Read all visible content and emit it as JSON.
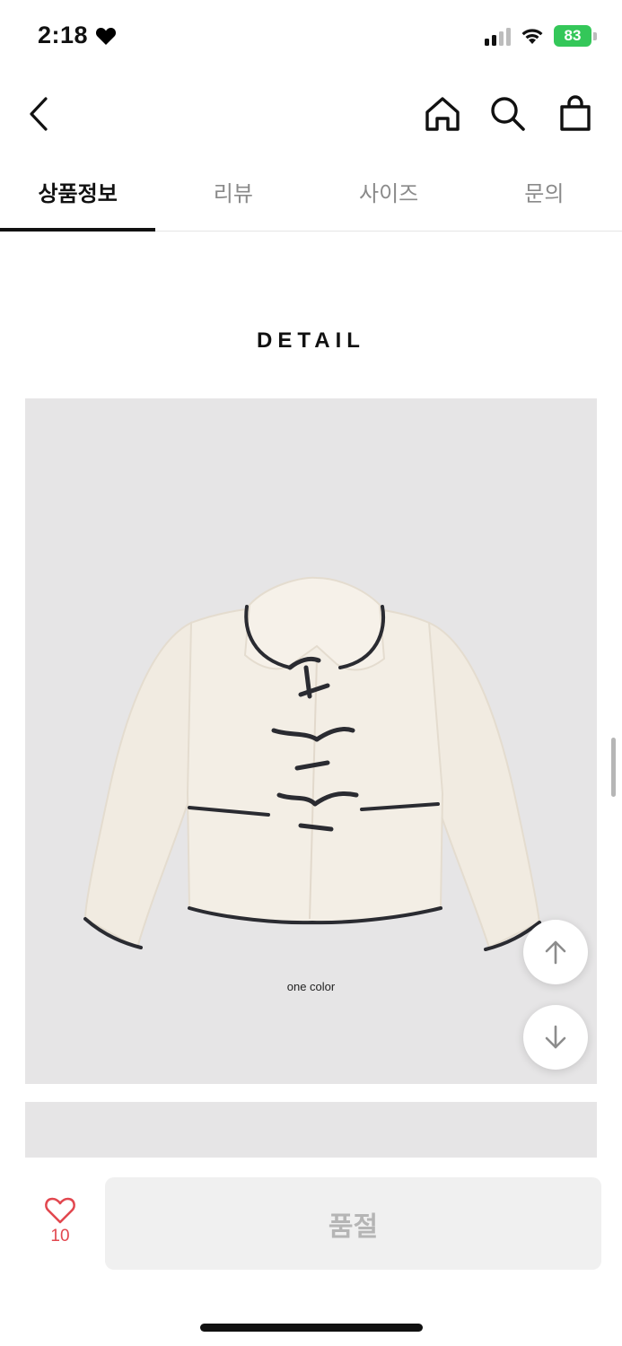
{
  "status_bar": {
    "time": "2:18",
    "battery": "83"
  },
  "tabs": [
    {
      "label": "상품정보",
      "active": true
    },
    {
      "label": "리뷰",
      "active": false
    },
    {
      "label": "사이즈",
      "active": false
    },
    {
      "label": "문의",
      "active": false
    }
  ],
  "detail": {
    "title": "DETAIL",
    "image_caption": "one color"
  },
  "bottom_bar": {
    "like_count": "10",
    "soldout_label": "품절"
  },
  "colors": {
    "accent_heart": "#e2474f",
    "battery_green": "#34c759",
    "image_bg": "#e6e5e6",
    "soldout_bg": "#f0f0f0"
  }
}
